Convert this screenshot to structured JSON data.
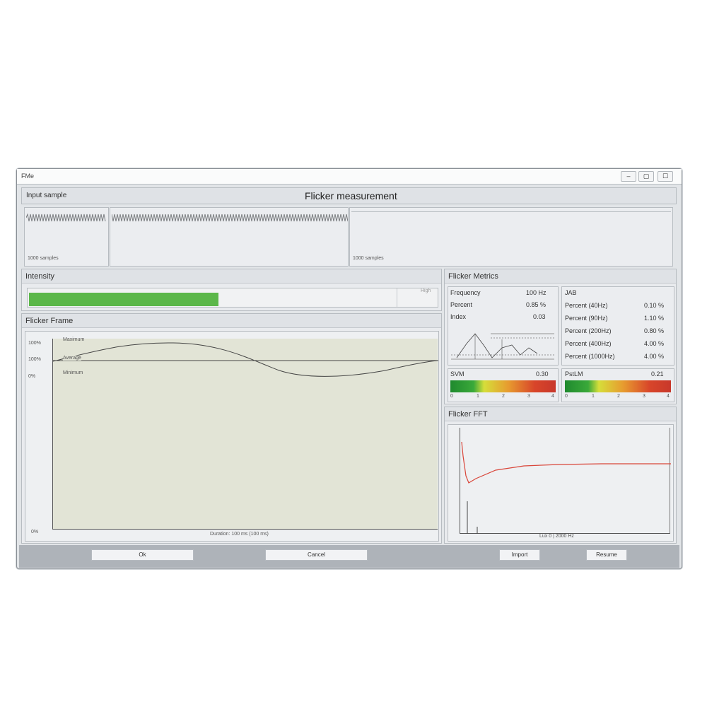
{
  "window": {
    "title": "FMe",
    "controls": [
      "–",
      "▢",
      "☐"
    ]
  },
  "header": {
    "input_label": "Input sample",
    "title": "Flicker measurement"
  },
  "input_sample": {
    "left_caption": "1000 samples",
    "right_caption": "1000 samples"
  },
  "intensity": {
    "label": "Intensity",
    "fill_fraction": 0.465,
    "fill_color": "#5bb749",
    "right_tag": "High"
  },
  "flicker_frame": {
    "label": "Flicker Frame",
    "y_labels": [
      "100%",
      "100%",
      "0%",
      "0%"
    ],
    "legend": [
      "Maximum",
      "Average",
      "Minimum"
    ],
    "x_caption": "Duration: 100 ms (100 ms)",
    "plot_bg": "#e2e4d6"
  },
  "flicker_metrics": {
    "label": "Flicker Metrics",
    "left": [
      {
        "k": "Frequency",
        "v": "100 Hz"
      },
      {
        "k": "Percent",
        "v": "0.85 %"
      },
      {
        "k": "Index",
        "v": "0.03"
      }
    ],
    "right_header": "JAB",
    "right": [
      {
        "k": "Percent (40Hz)",
        "v": "0.10 %"
      },
      {
        "k": "Percent (90Hz)",
        "v": "1.10 %"
      },
      {
        "k": "Percent (200Hz)",
        "v": "0.80 %"
      },
      {
        "k": "Percent (400Hz)",
        "v": "4.00 %"
      },
      {
        "k": "Percent (1000Hz)",
        "v": "4.00 %"
      }
    ],
    "svm": {
      "label": "SVM",
      "value": "0.30",
      "ticks": [
        "0",
        "1",
        "2",
        "3",
        "4"
      ]
    },
    "pstlm": {
      "label": "PstLM",
      "value": "0.21",
      "ticks": [
        "0",
        "1",
        "2",
        "3",
        "4"
      ]
    }
  },
  "flicker_fft": {
    "label": "Flicker FFT",
    "x_caption": "Lux 0 | 2000 Hz",
    "line_color": "#d9463a"
  },
  "buttons": {
    "ok": "Ok",
    "cancel": "Cancel",
    "import": "Import",
    "resume": "Resume"
  }
}
